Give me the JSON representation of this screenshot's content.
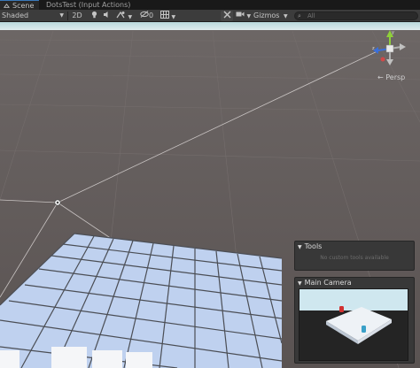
{
  "tabs": [
    {
      "label": "Scene",
      "icon": "scene-icon"
    },
    {
      "label": "DotsTest (Input Actions)",
      "icon": "input-actions-icon"
    }
  ],
  "toolbar": {
    "shading_mode": "Shaded",
    "mode_2d": "2D",
    "hidden_count": "0",
    "gizmos": "Gizmos",
    "search_placeholder": "All"
  },
  "scene": {
    "projection": "Persp",
    "sky_color": "#dfeef2",
    "ground_color": "#5f5857",
    "grid_color": "#b8c8dc"
  },
  "overlays": {
    "tools_title": "Tools",
    "tools_message": "No custom tools available",
    "camera_title": "Main Camera"
  }
}
